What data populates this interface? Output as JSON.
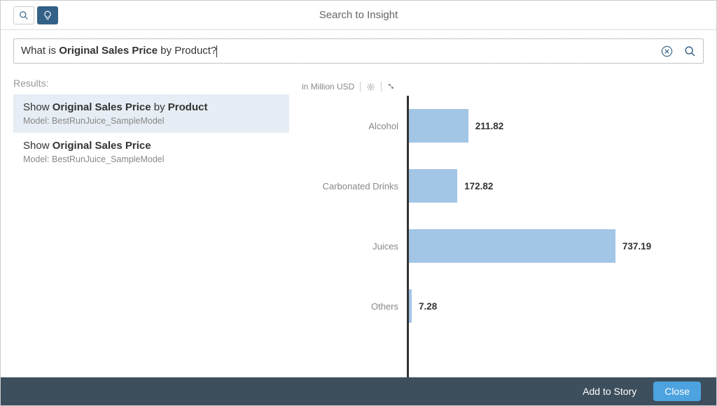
{
  "header": {
    "title": "Search to Insight"
  },
  "search": {
    "prefix": "What is ",
    "bold": "Original Sales Price",
    "middle": " by Product?"
  },
  "results": {
    "label": "Results:",
    "items": [
      {
        "pre": "Show ",
        "bold": "Original Sales Price",
        "mid": " by ",
        "bold2": "Product",
        "model": "Model: BestRunJuice_SampleModel"
      },
      {
        "pre": "Show ",
        "bold": "Original Sales Price",
        "mid": "",
        "bold2": "",
        "model": "Model: BestRunJuice_SampleModel"
      }
    ]
  },
  "chart_header": {
    "unit": "in Million USD"
  },
  "chart_data": {
    "type": "bar",
    "orientation": "horizontal",
    "title": "",
    "xlabel": "in Million USD",
    "ylabel": "",
    "categories": [
      "Alcohol",
      "Carbonated Drinks",
      "Juices",
      "Others"
    ],
    "values": [
      211.82,
      172.82,
      737.19,
      7.28
    ],
    "xlim": [
      0,
      800
    ]
  },
  "footer": {
    "add": "Add to Story",
    "close": "Close"
  }
}
